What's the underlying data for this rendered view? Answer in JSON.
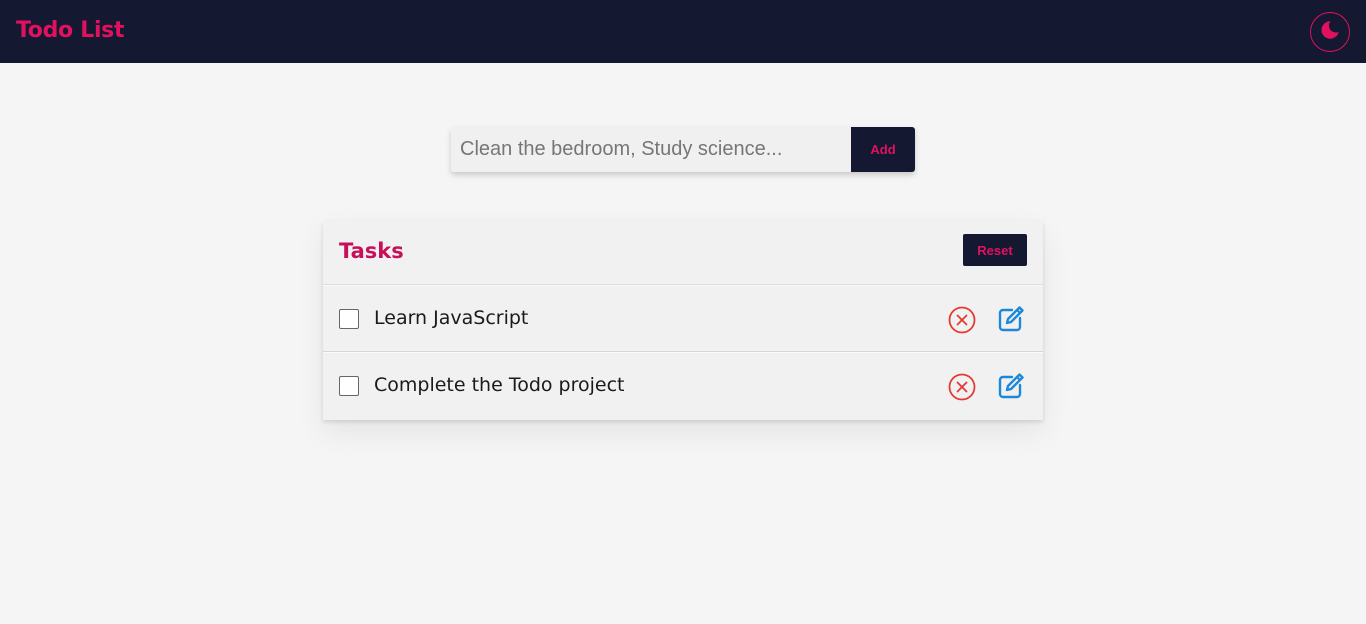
{
  "navbar": {
    "brand": "Todo List",
    "theme_toggle_icon": "moon-icon",
    "background": "#141830",
    "accent": "#e0115f"
  },
  "add_form": {
    "placeholder": "Clean the bedroom, Study science...",
    "value": "",
    "add_label": "Add"
  },
  "tasks": {
    "title": "Tasks",
    "reset_label": "Reset",
    "items": [
      {
        "text": "Learn JavaScript",
        "completed": false
      },
      {
        "text": "Complete the Todo project",
        "completed": false
      }
    ],
    "delete_icon": "circle-x-icon",
    "edit_icon": "edit-icon",
    "delete_color": "#e53935",
    "edit_color": "#1e88d8"
  }
}
